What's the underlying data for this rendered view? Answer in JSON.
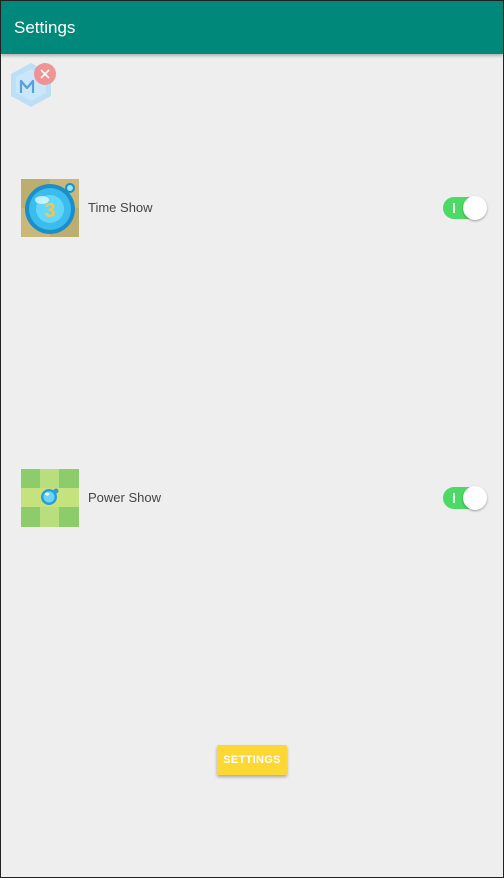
{
  "appbar": {
    "title": "Settings",
    "color": "#00897b"
  },
  "floating_widget": {
    "icon": "m-hexagon-icon",
    "close_icon": "close-icon"
  },
  "settings": [
    {
      "icon": "timer-orb-icon",
      "label": "Time Show",
      "enabled": true
    },
    {
      "icon": "power-grid-icon",
      "label": "Power Show",
      "enabled": true
    }
  ],
  "footer": {
    "button_label": "SETTINGS",
    "button_color": "#fdd835"
  },
  "colors": {
    "switch_on": "#4cd964",
    "background": "#eeeeee"
  }
}
